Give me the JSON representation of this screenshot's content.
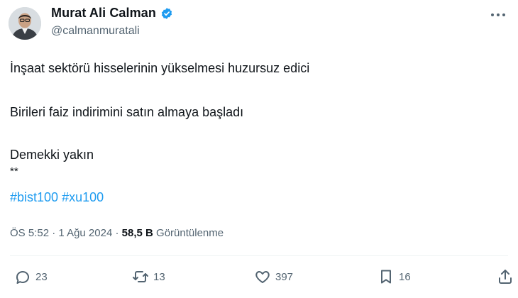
{
  "author": {
    "display_name": "Murat Ali Calman",
    "handle": "@calmanmuratali"
  },
  "tweet": {
    "lines": [
      "İnşaat sektörü hisselerinin yükselmesi huzursuz edici",
      "Birileri faiz indirimini satın almaya başladı",
      "Demekki yakın",
      "**"
    ],
    "hashtags": [
      "#bist100",
      "#xu100"
    ]
  },
  "meta": {
    "time": "ÖS 5:52",
    "separator": "·",
    "date": "1 Ağu 2024",
    "views_count": "58,5 B",
    "views_label": "Görüntülenme"
  },
  "actions": {
    "replies": "23",
    "retweets": "13",
    "likes": "397",
    "bookmarks": "16"
  },
  "colors": {
    "accent": "#1d9bf0",
    "text": "#0f1419",
    "muted": "#536471"
  },
  "icons": [
    "verified-badge-icon",
    "more-icon",
    "reply-icon",
    "retweet-icon",
    "like-icon",
    "bookmark-icon",
    "share-icon"
  ]
}
